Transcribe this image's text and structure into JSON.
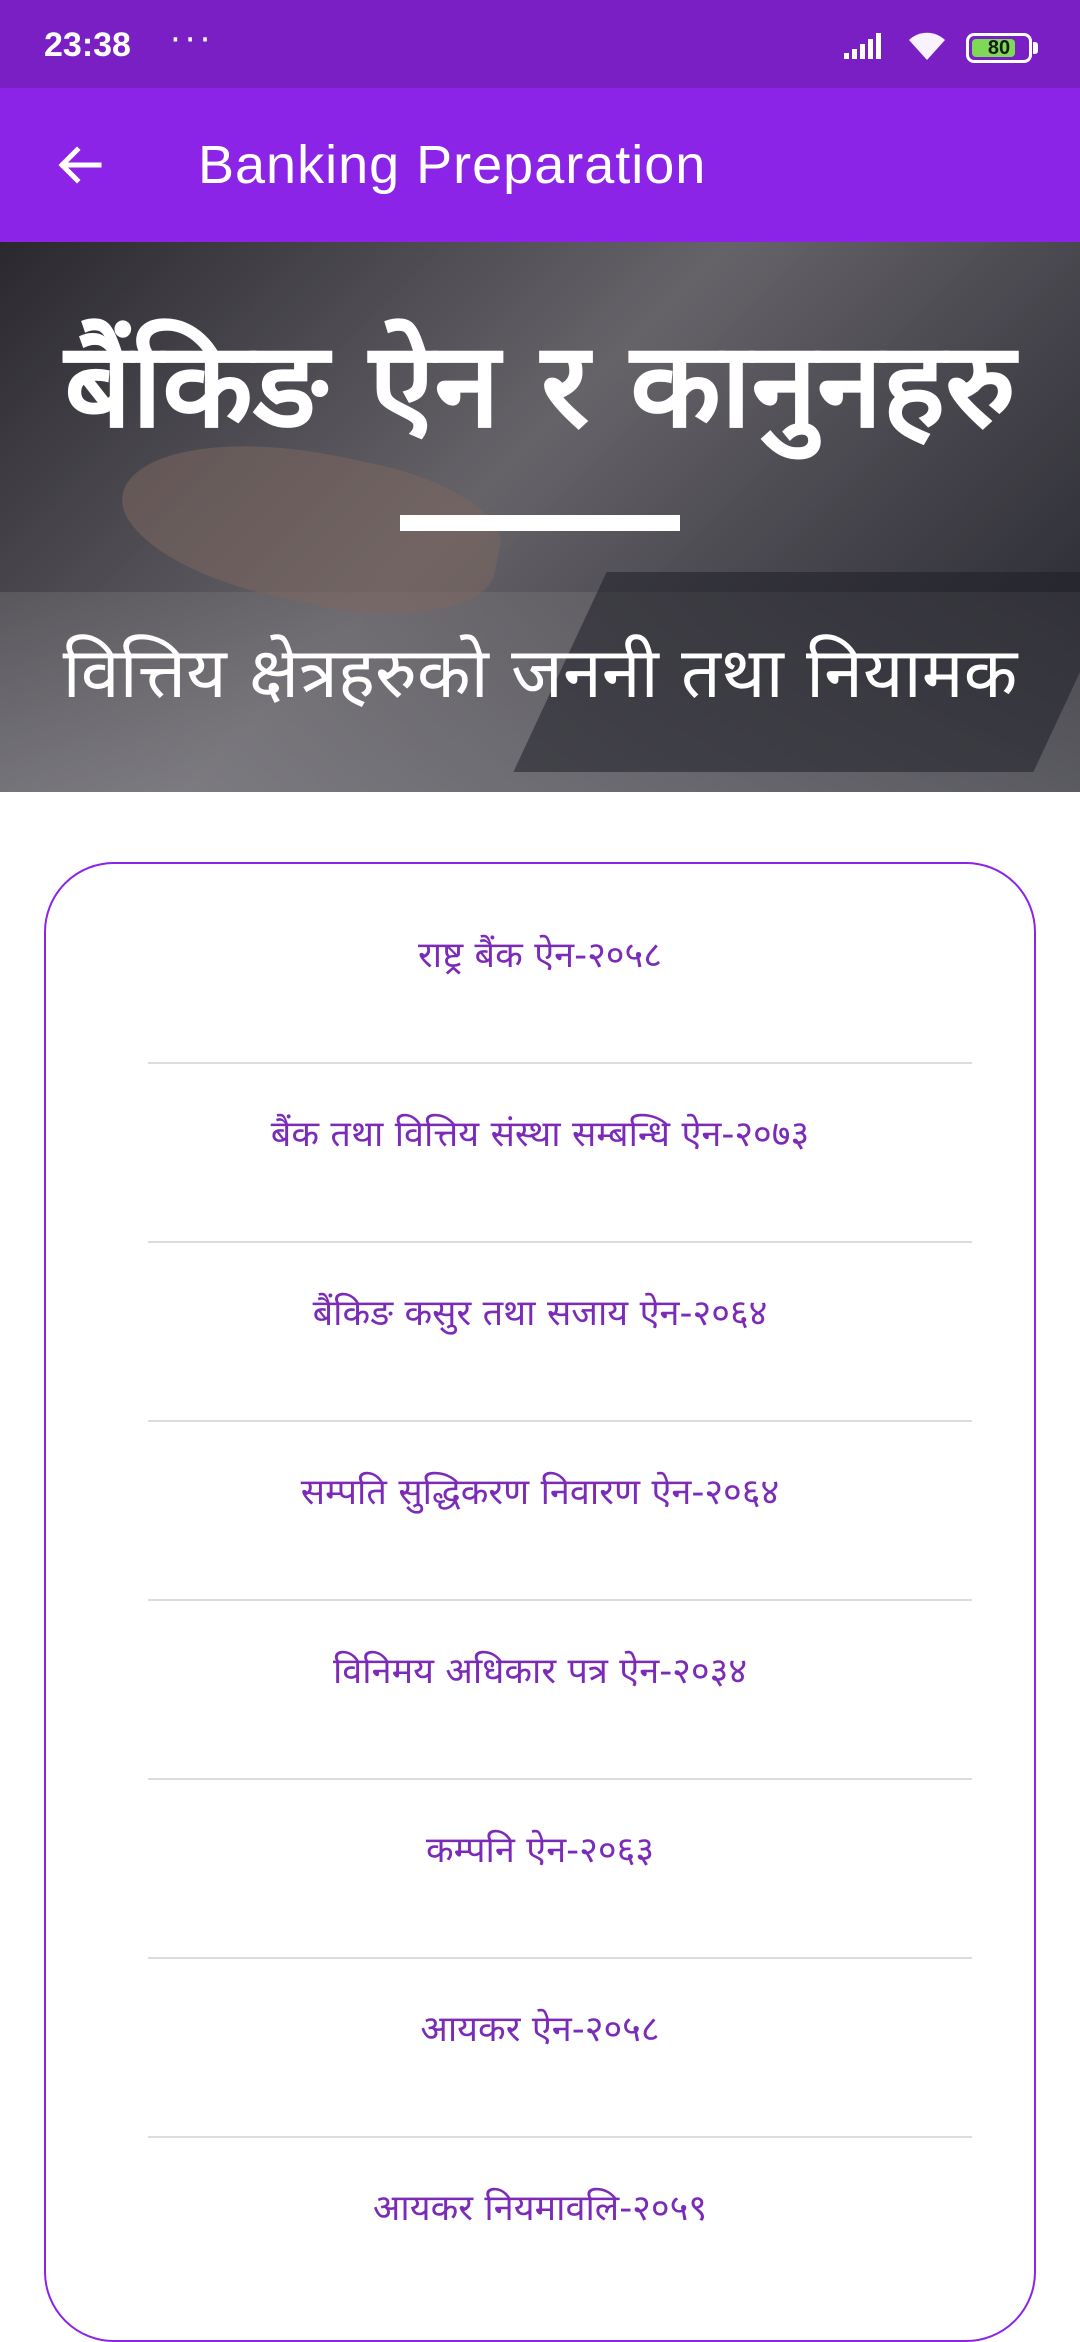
{
  "status_bar": {
    "time": "23:38",
    "dots": "···",
    "battery": "80",
    "battery_fraction": 0.8,
    "icons": [
      "signal-icon",
      "wifi-icon",
      "battery-icon"
    ]
  },
  "app_bar": {
    "title": "Banking Preparation",
    "back_icon": "arrow-left-icon"
  },
  "hero": {
    "title": "बैंकिङ ऐन र कानुनहरु",
    "subtitle": "वित्तिय क्षेत्रहरुको जननी तथा नियामक"
  },
  "colors": {
    "status_bar": "#7a1fc4",
    "app_bar": "#8b24e6",
    "list_text": "#7b2bb8",
    "card_border": "#8b24e6",
    "divider": "#dcdcdc"
  },
  "acts": [
    "राष्ट्र बैंक ऐन-२०५८",
    "बैंक तथा वित्तिय संस्था सम्बन्धि ऐन-२०७३",
    "बैंकिङ कसुर तथा सजाय ऐन-२०६४",
    "सम्पति सुद्धिकरण निवारण ऐन-२०६४",
    "विनिमय अधिकार पत्र ऐन-२०३४",
    "कम्पनि ऐन-२०६३",
    "आयकर ऐन-२०५८",
    "आयकर नियमावलि-२०५९"
  ]
}
